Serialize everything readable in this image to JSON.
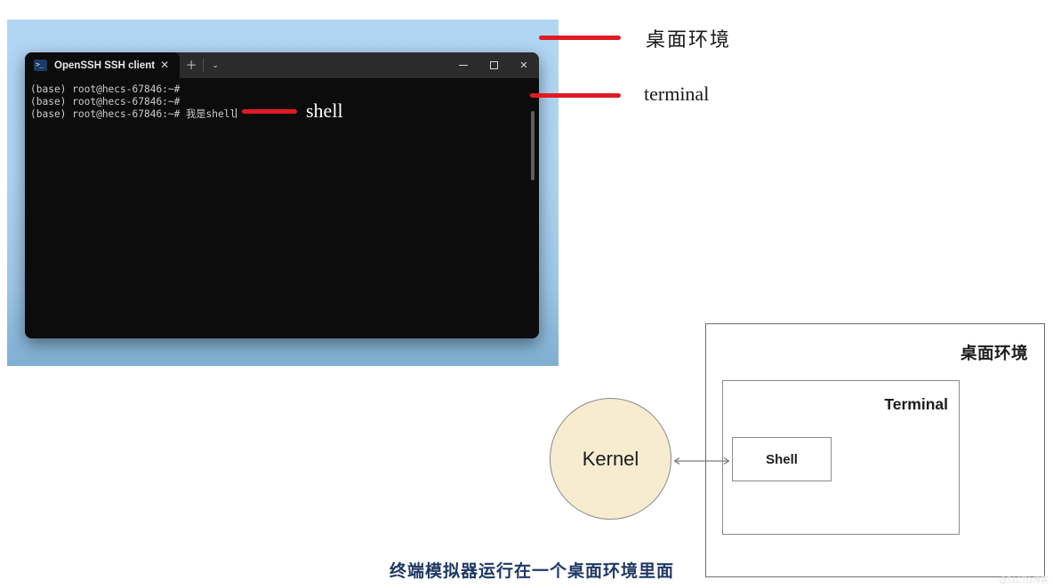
{
  "colors": {
    "desktop_blue_top": "#b1d6f4",
    "desktop_blue_bottom": "#7fafd2",
    "annotation_red": "#e01b22",
    "terminal_bg": "#0c0c0c",
    "terminal_titlebar": "#2b2b2b",
    "kernel_fill": "#f7ecd0",
    "diagram_border": "#6d6d6d",
    "caption_navy": "#203864"
  },
  "terminal": {
    "tab": {
      "icon": "powershell-prompt-icon",
      "title": "OpenSSH SSH client",
      "close_label": "✕",
      "new_tab_label": "＋",
      "dropdown_label": "⌄"
    },
    "window_controls": {
      "minimize_label": "—",
      "maximize_label": "□",
      "close_label": "✕"
    },
    "lines": [
      "(base) root@hecs-67846:~#",
      "(base) root@hecs-67846:~#",
      "(base) root@hecs-67846:~# 我是shell"
    ]
  },
  "annotations": {
    "desktop_label": "桌面环境",
    "terminal_label": "terminal",
    "shell_label": "shell"
  },
  "diagram": {
    "desktop_env_label": "桌面环境",
    "terminal_label": "Terminal",
    "shell_label": "Shell",
    "kernel_label": "Kernel"
  },
  "caption": "终端模拟器运行在一个桌面环境里面",
  "watermark": "@51CTO博客"
}
